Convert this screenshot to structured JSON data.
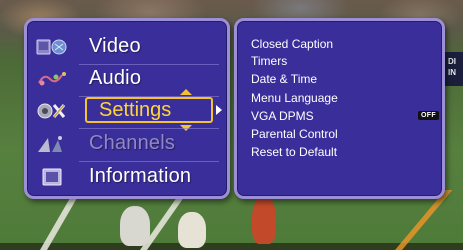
{
  "main_menu": {
    "items": [
      {
        "label": "Video",
        "icon": "video-icon",
        "state": "normal"
      },
      {
        "label": "Audio",
        "icon": "audio-icon",
        "state": "normal"
      },
      {
        "label": "Settings",
        "icon": "settings-icon",
        "state": "selected"
      },
      {
        "label": "Channels",
        "icon": "channels-icon",
        "state": "disabled"
      },
      {
        "label": "Information",
        "icon": "information-icon",
        "state": "normal"
      }
    ]
  },
  "submenu": {
    "items": [
      {
        "label": "Closed Caption"
      },
      {
        "label": "Timers"
      },
      {
        "label": "Date & Time"
      },
      {
        "label": "Menu Language"
      },
      {
        "label": "VGA DPMS",
        "value": "OFF"
      },
      {
        "label": "Parental Control"
      },
      {
        "label": "Reset to Default"
      }
    ]
  },
  "scorebug": {
    "line1": "DI",
    "line2": "IN"
  },
  "colors": {
    "panel_bg": "#3a2f9a",
    "panel_border": "#9c8fd6",
    "highlight": "#f2c230",
    "disabled_text": "#8f87c6"
  }
}
